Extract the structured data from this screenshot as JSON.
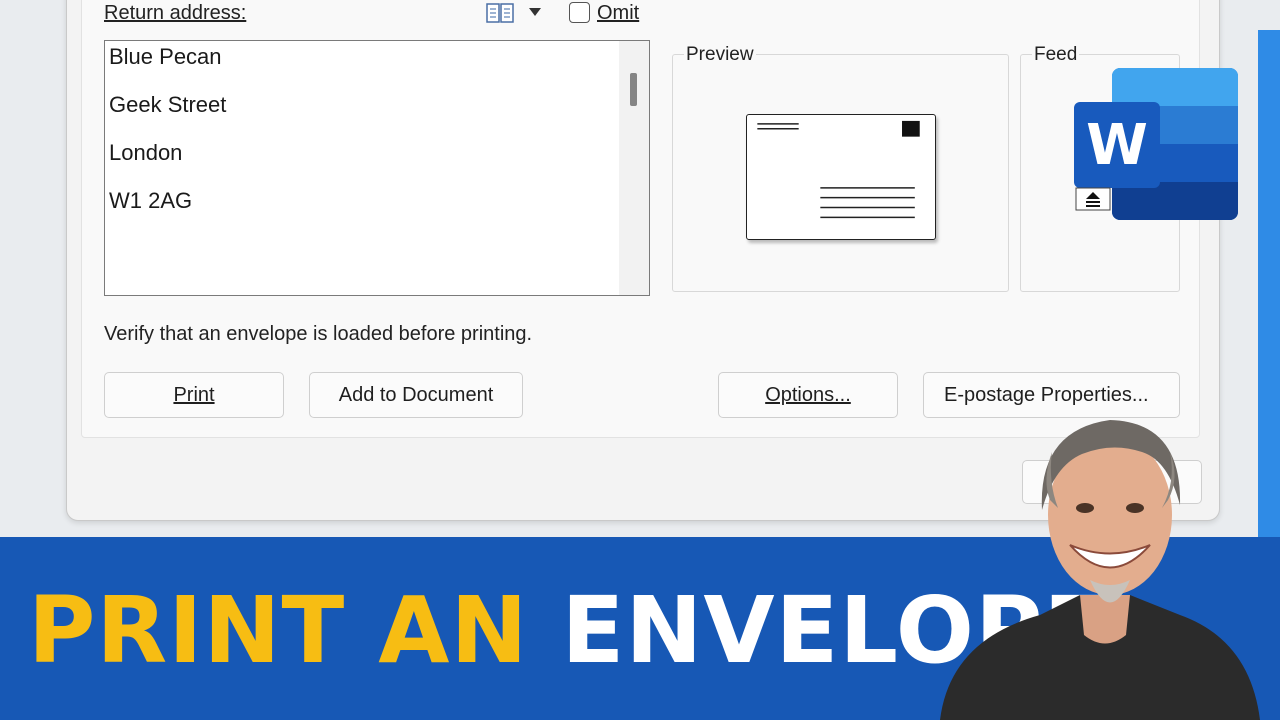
{
  "dialog": {
    "return_address_label": "Return address:",
    "omit_label": "Omit",
    "address_lines": [
      "Blue Pecan",
      "Geek Street",
      "London",
      "W1 2AG"
    ],
    "preview_title": "Preview",
    "feed_title": "Feed",
    "verify_text": "Verify that an envelope is loaded before printing.",
    "buttons": {
      "print": "Print",
      "add_to_document": "Add to Document",
      "options": "Options...",
      "epostage": "E-postage Properties..."
    }
  },
  "banner": {
    "title_part1": "PRINT AN",
    "title_part2": "ENVELOPE",
    "colors": {
      "background": "#1758b5",
      "highlight": "#f7bd13",
      "text": "#ffffff"
    }
  },
  "logo": {
    "letter": "W",
    "icon": "microsoft-word-logo"
  }
}
